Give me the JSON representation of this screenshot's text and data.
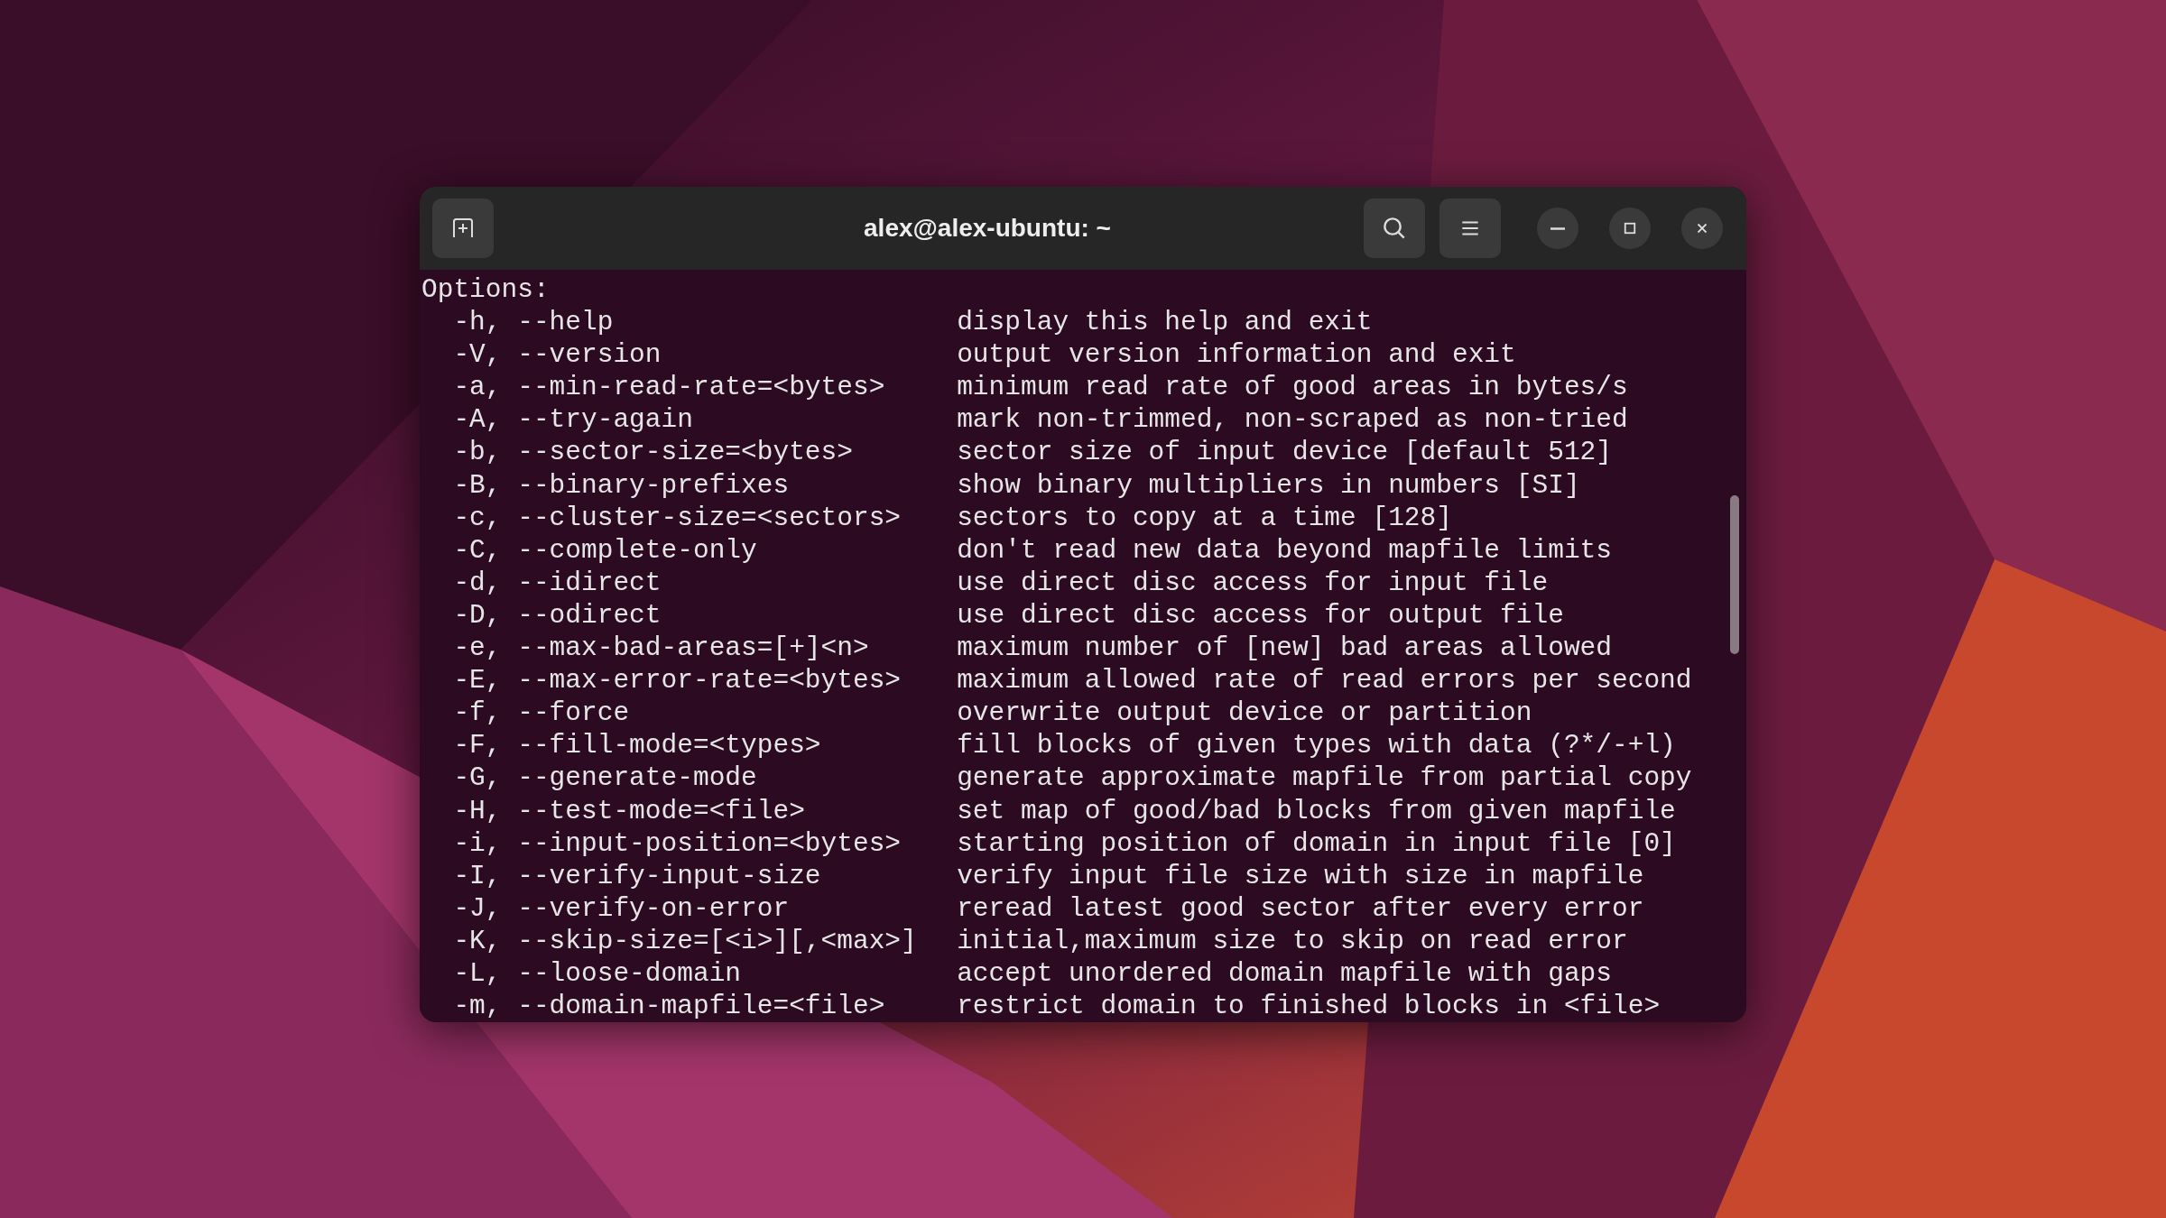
{
  "window": {
    "title": "alex@alex-ubuntu: ~"
  },
  "terminal": {
    "heading": "Options:",
    "rows": [
      {
        "option": "-h, --help",
        "description": "display this help and exit"
      },
      {
        "option": "-V, --version",
        "description": "output version information and exit"
      },
      {
        "option": "-a, --min-read-rate=<bytes>",
        "description": "minimum read rate of good areas in bytes/s"
      },
      {
        "option": "-A, --try-again",
        "description": "mark non-trimmed, non-scraped as non-tried"
      },
      {
        "option": "-b, --sector-size=<bytes>",
        "description": "sector size of input device [default 512]"
      },
      {
        "option": "-B, --binary-prefixes",
        "description": "show binary multipliers in numbers [SI]"
      },
      {
        "option": "-c, --cluster-size=<sectors>",
        "description": "sectors to copy at a time [128]"
      },
      {
        "option": "-C, --complete-only",
        "description": "don't read new data beyond mapfile limits"
      },
      {
        "option": "-d, --idirect",
        "description": "use direct disc access for input file"
      },
      {
        "option": "-D, --odirect",
        "description": "use direct disc access for output file"
      },
      {
        "option": "-e, --max-bad-areas=[+]<n>",
        "description": "maximum number of [new] bad areas allowed"
      },
      {
        "option": "-E, --max-error-rate=<bytes>",
        "description": "maximum allowed rate of read errors per second"
      },
      {
        "option": "-f, --force",
        "description": "overwrite output device or partition"
      },
      {
        "option": "-F, --fill-mode=<types>",
        "description": "fill blocks of given types with data (?*/-+l)"
      },
      {
        "option": "-G, --generate-mode",
        "description": "generate approximate mapfile from partial copy"
      },
      {
        "option": "-H, --test-mode=<file>",
        "description": "set map of good/bad blocks from given mapfile"
      },
      {
        "option": "-i, --input-position=<bytes>",
        "description": "starting position of domain in input file [0]"
      },
      {
        "option": "-I, --verify-input-size",
        "description": "verify input file size with size in mapfile"
      },
      {
        "option": "-J, --verify-on-error",
        "description": "reread latest good sector after every error"
      },
      {
        "option": "-K, --skip-size=[<i>][,<max>]",
        "description": "initial,maximum size to skip on read error"
      },
      {
        "option": "-L, --loose-domain",
        "description": "accept unordered domain mapfile with gaps"
      },
      {
        "option": "-m, --domain-mapfile=<file>",
        "description": "restrict domain to finished blocks in <file>"
      }
    ]
  }
}
